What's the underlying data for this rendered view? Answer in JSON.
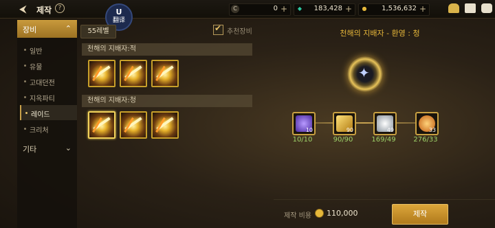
{
  "header": {
    "back_icon": "back-arrow-icon",
    "title": "제작",
    "help_label": "?"
  },
  "overlay_badge": {
    "top": "U",
    "bottom": "翻译"
  },
  "currencies": [
    {
      "icon": "c-coin-icon",
      "glyph": "C",
      "value": "0",
      "color": "#9a8f7a"
    },
    {
      "icon": "gem-icon",
      "glyph": "◆",
      "value": "183,428",
      "color": "#2fc9a2"
    },
    {
      "icon": "gold-coin-icon",
      "glyph": "●",
      "value": "1,536,632",
      "color": "#e6b83a"
    }
  ],
  "sidebar": {
    "category": "장비",
    "items": [
      "일반",
      "유물",
      "고대던전",
      "지옥파티",
      "레이드",
      "크리처"
    ],
    "selected_index": 4,
    "other": "기타"
  },
  "filter": {
    "level_tab": "55레벨",
    "recommended_label": "추천장비",
    "recommended_checked": true
  },
  "groups": [
    {
      "title": "천해의 지배자:적",
      "slots": 3
    },
    {
      "title": "천해의 지배자:청",
      "slots": 3,
      "selected": 0
    }
  ],
  "detail": {
    "title": "천해의 지배자 - 환영 : 청",
    "materials": [
      {
        "icon": "purple-gem-icon",
        "count": "10",
        "label": "10/10",
        "color": "#7a4ad0"
      },
      {
        "icon": "gold-bar-icon",
        "count": "90",
        "label": "90/90",
        "color": "#d8a72a"
      },
      {
        "icon": "diamond-icon",
        "count": "49",
        "label": "169/49",
        "color": "#cfd8e0"
      },
      {
        "icon": "gold-orb-icon",
        "count": "33",
        "label": "276/33",
        "color": "#e8902a"
      }
    ]
  },
  "footer": {
    "cost_label": "제작 비용",
    "cost_value": "110,000",
    "make_button": "제작"
  }
}
